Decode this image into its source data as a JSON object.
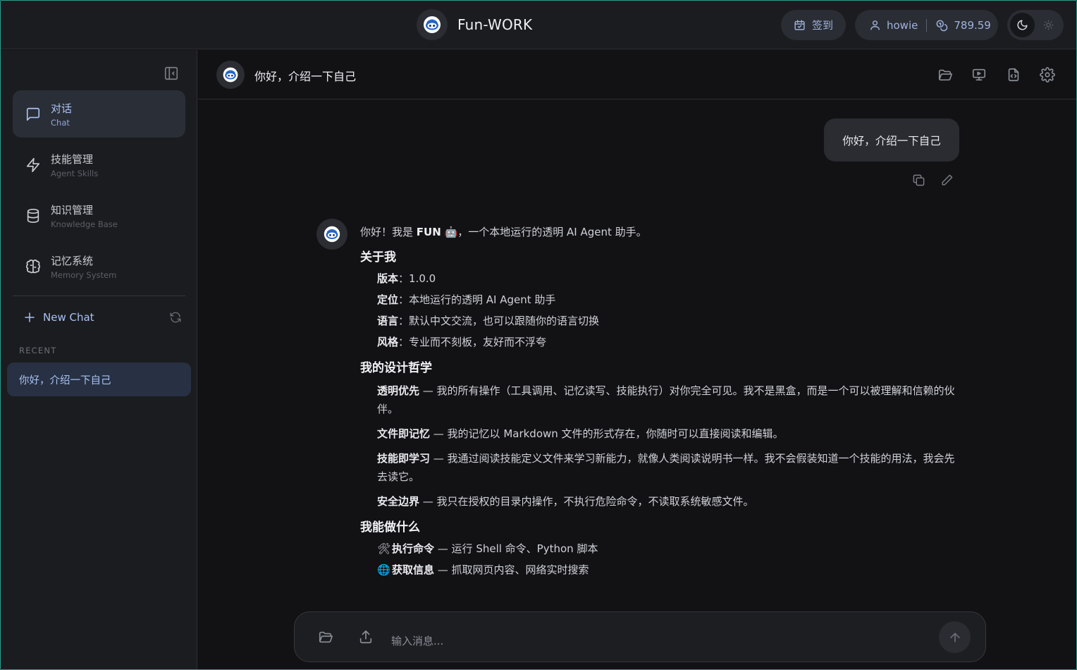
{
  "header": {
    "brand": "Fun-WORK",
    "checkin_label": "签到",
    "username": "howie",
    "balance": "789.59"
  },
  "sidebar": {
    "nav": [
      {
        "zh": "对话",
        "en": "Chat",
        "icon": "chat-bubble-icon",
        "active": true
      },
      {
        "zh": "技能管理",
        "en": "Agent Skills",
        "icon": "lightning-icon"
      },
      {
        "zh": "知识管理",
        "en": "Knowledge Base",
        "icon": "database-icon"
      },
      {
        "zh": "记忆系统",
        "en": "Memory System",
        "icon": "brain-icon"
      }
    ],
    "new_chat": "New Chat",
    "recent_label": "RECENT",
    "recent": [
      "你好，介绍一下自己"
    ]
  },
  "chat": {
    "title": "你好，介绍一下自己",
    "user_message": "你好，介绍一下自己",
    "answer": {
      "intro_pre": "你好！我是 ",
      "intro_name": "FUN",
      "intro_emoji": "🤖",
      "intro_post": "，一个本地运行的透明 AI Agent 助手。",
      "about_heading": "关于我",
      "about": [
        {
          "k": "版本",
          "v": "：1.0.0"
        },
        {
          "k": "定位",
          "v": "：本地运行的透明 AI Agent 助手"
        },
        {
          "k": "语言",
          "v": "：默认中文交流，也可以跟随你的语言切换"
        },
        {
          "k": "风格",
          "v": "：专业而不刻板，友好而不浮夸"
        }
      ],
      "philosophy_heading": "我的设计哲学",
      "philosophy": [
        {
          "k": "透明优先",
          "v": " — 我的所有操作（工具调用、记忆读写、技能执行）对你完全可见。我不是黑盒，而是一个可以被理解和信赖的伙伴。"
        },
        {
          "k": "文件即记忆",
          "v": " — 我的记忆以 Markdown 文件的形式存在，你随时可以直接阅读和编辑。"
        },
        {
          "k": "技能即学习",
          "v": " — 我通过阅读技能定义文件来学习新能力，就像人类阅读说明书一样。我不会假装知道一个技能的用法，我会先去读它。"
        },
        {
          "k": "安全边界",
          "v": " — 我只在授权的目录内操作，不执行危险命令，不读取系统敏感文件。"
        }
      ],
      "abilities_heading": "我能做什么",
      "abilities": [
        {
          "emoji": "🛠",
          "k": "执行命令",
          "v": " — 运行 Shell 命令、Python 脚本"
        },
        {
          "emoji": "🌐",
          "k": "获取信息",
          "v": " — 抓取网页内容、网络实时搜索"
        }
      ]
    }
  },
  "composer": {
    "placeholder": "输入消息..."
  }
}
